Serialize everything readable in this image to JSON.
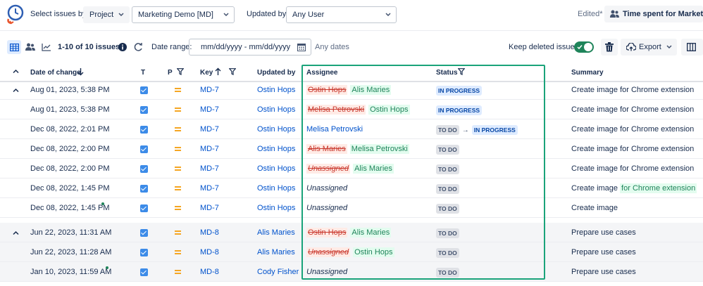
{
  "header": {
    "select_by_label": "Select issues by:",
    "select_by_value": "Project",
    "project_value": "Marketing Demo [MD]",
    "updated_by_label": "Updated by:",
    "updated_by_value": "Any User",
    "edited_label": "Edited*",
    "time_spent_label": "Time spent for Market..."
  },
  "toolbar": {
    "count_text": "1-10 of 10 issues",
    "date_range_label": "Date range:",
    "date_placeholder": "mm/dd/yyyy - mm/dd/yyyy",
    "any_dates": "Any dates",
    "keep_deleted_label": "Keep deleted issues",
    "export_label": "Export"
  },
  "columns": {
    "date": "Date of change",
    "type": "T",
    "priority": "P",
    "key": "Key",
    "updated_by": "Updated by",
    "assignee": "Assignee",
    "status": "Status",
    "summary": "Summary"
  },
  "rows": [
    {
      "date": "Aug 01, 2023, 5:38 PM",
      "key": "MD-7",
      "updated_by": "Ostin Hops",
      "assignee_old": "Ostin Hops",
      "assignee_new": "Alis Maries",
      "status_from": "",
      "status_to": "IN PROGRESS",
      "summary": "Create image for Chrome extension",
      "summary_added": ""
    },
    {
      "date": "Aug 01, 2023, 5:38 PM",
      "key": "MD-7",
      "updated_by": "Ostin Hops",
      "assignee_old": "Melisa Petrovski",
      "assignee_new": "Ostin Hops",
      "status_from": "",
      "status_to": "IN PROGRESS",
      "summary": "Create image for Chrome extension",
      "summary_added": ""
    },
    {
      "date": "Dec 08, 2022, 2:01 PM",
      "key": "MD-7",
      "updated_by": "Ostin Hops",
      "assignee_plain": "Melisa Petrovski",
      "status_from": "TO DO",
      "status_to": "IN PROGRESS",
      "summary": "Create image for Chrome extension",
      "summary_added": ""
    },
    {
      "date": "Dec 08, 2022, 2:00 PM",
      "key": "MD-7",
      "updated_by": "Ostin Hops",
      "assignee_old": "Alis Maries",
      "assignee_new": "Melisa Petrovski",
      "status_from": "",
      "status_to": "TO DO",
      "summary": "Create image for Chrome extension",
      "summary_added": ""
    },
    {
      "date": "Dec 08, 2022, 2:00 PM",
      "key": "MD-7",
      "updated_by": "Ostin Hops",
      "assignee_old": "Unassigned",
      "assignee_new": "Alis Maries",
      "status_from": "",
      "status_to": "TO DO",
      "summary": "Create image for Chrome extension",
      "summary_added": ""
    },
    {
      "date": "Dec 08, 2022, 1:45 PM",
      "key": "MD-7",
      "updated_by": "Ostin Hops",
      "assignee_plain": "Unassigned",
      "status_from": "",
      "status_to": "TO DO",
      "summary": "Create image",
      "summary_added": "for Chrome extension"
    },
    {
      "date": "Dec 08, 2022, 1:45 PM",
      "key": "MD-7",
      "updated_by": "Ostin Hops",
      "assignee_plain": "Unassigned",
      "status_from": "",
      "status_to": "TO DO",
      "summary": "Create image",
      "summary_added": ""
    },
    {
      "date": "Jun 22, 2023, 11:31 AM",
      "key": "MD-8",
      "updated_by": "Alis Maries",
      "assignee_old": "Ostin Hops",
      "assignee_new": "Alis Maries",
      "status_from": "",
      "status_to": "TO DO",
      "summary": "Prepare use cases",
      "summary_added": ""
    },
    {
      "date": "Jun 22, 2023, 11:28 AM",
      "key": "MD-8",
      "updated_by": "Alis Maries",
      "assignee_old": "Unassigned",
      "assignee_new": "Ostin Hops",
      "status_from": "",
      "status_to": "TO DO",
      "summary": "Prepare use cases",
      "summary_added": ""
    },
    {
      "date": "Jan 10, 2023, 11:59 AM",
      "key": "MD-8",
      "updated_by": "Cody Fisher",
      "assignee_plain": "Unassigned",
      "status_from": "",
      "status_to": "TO DO",
      "summary": "Prepare use cases",
      "summary_added": ""
    }
  ],
  "colors": {
    "accent": "#0052cc",
    "highlight_border": "#1aa37a",
    "toggle_on": "#1f845a",
    "priority_medium": "#f5a623"
  }
}
